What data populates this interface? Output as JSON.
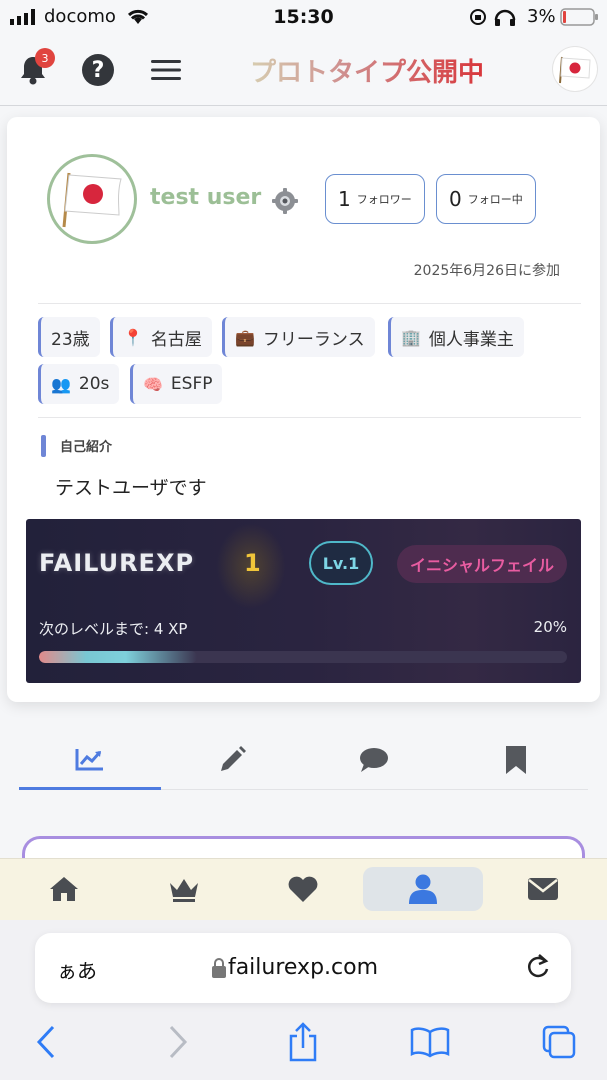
{
  "status_bar": {
    "carrier": "docomo",
    "time": "15:30",
    "battery": "3%"
  },
  "header": {
    "notification_count": "3",
    "brand": "プロトタイプ公開中"
  },
  "profile": {
    "username": "test user",
    "followers": {
      "count": "1",
      "label": "フォロワー"
    },
    "following": {
      "count": "0",
      "label": "フォロー中"
    },
    "joined": "2025年6月26日に参加",
    "tags": [
      {
        "emoji": "",
        "text": "23歳"
      },
      {
        "emoji": "📍",
        "text": "名古屋"
      },
      {
        "emoji": "💼",
        "text": "フリーランス"
      },
      {
        "emoji": "🏢",
        "text": "個人事業主"
      },
      {
        "emoji": "👥",
        "text": "20s"
      },
      {
        "emoji": "🧠",
        "text": "ESFP"
      }
    ],
    "intro_label": "自己紹介",
    "intro_text": "テストユーザです"
  },
  "xp": {
    "logo": "FAILUREXP",
    "level_number": "1",
    "level_badge": "Lv.1",
    "title": "イニシャルフェイル",
    "next_level": "次のレベルまで: 4 XP",
    "percent_label": "20%",
    "progress_fraction": 0.2
  },
  "tabs": [
    "stats",
    "posts",
    "comments",
    "bookmarks"
  ],
  "bottom_nav": [
    "home",
    "ranking",
    "likes",
    "profile",
    "messages"
  ],
  "browser": {
    "aa": "ぁあ",
    "url": "failurexp.com"
  },
  "colors": {
    "accent": "#6f86d6",
    "username": "#9cbf96",
    "active_tab": "#4e7be0",
    "badge": "#e0443f"
  }
}
